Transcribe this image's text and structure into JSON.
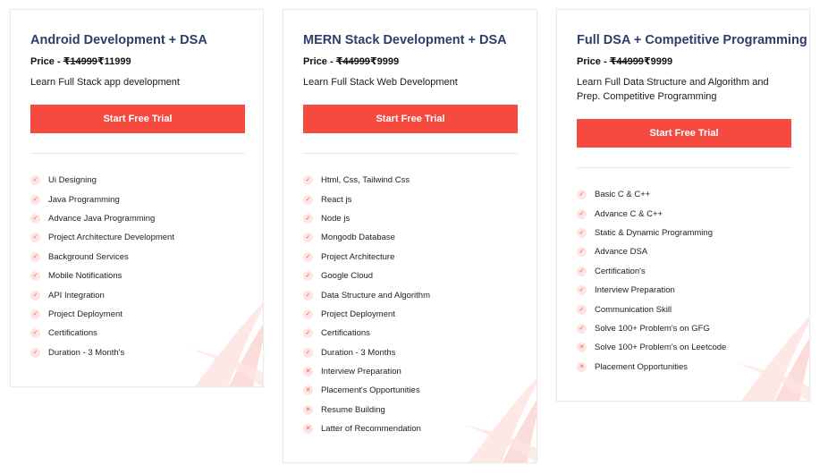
{
  "colors": {
    "accent": "#f44a3f",
    "title": "#2d3e6b",
    "check_bg": "#fde5e3",
    "check_fg": "#f15b50"
  },
  "plans": [
    {
      "title": "Android Development + DSA",
      "price_label": "Price - ",
      "old_price": "₹14999",
      "new_price": "₹11999",
      "description": "Learn Full Stack app development",
      "cta": "Start Free Trial",
      "features": [
        {
          "text": "Ui Designing",
          "icon": "check-icon",
          "glyph": "✓"
        },
        {
          "text": "Java Programming",
          "icon": "check-icon",
          "glyph": "✓"
        },
        {
          "text": "Advance Java Programming",
          "icon": "check-icon",
          "glyph": "✓"
        },
        {
          "text": "Project Architecture Development",
          "icon": "check-icon",
          "glyph": "✓"
        },
        {
          "text": "Background Services",
          "icon": "check-icon",
          "glyph": "✓"
        },
        {
          "text": "Mobile Notifications",
          "icon": "check-icon",
          "glyph": "✓"
        },
        {
          "text": "API Integration",
          "icon": "check-icon",
          "glyph": "✓"
        },
        {
          "text": "Project Deployment",
          "icon": "check-icon",
          "glyph": "✓"
        },
        {
          "text": "Certifications",
          "icon": "check-icon",
          "glyph": "✓"
        },
        {
          "text": "Duration - 3 Month's",
          "icon": "check-icon",
          "glyph": "✓"
        }
      ]
    },
    {
      "title": "MERN Stack Development + DSA",
      "price_label": "Price - ",
      "old_price": "₹44999",
      "new_price": "₹9999",
      "description": "Learn Full Stack Web Development",
      "cta": "Start Free Trial",
      "features": [
        {
          "text": "Html, Css, Tailwind Css",
          "icon": "check-icon",
          "glyph": "✓"
        },
        {
          "text": "React js",
          "icon": "check-icon",
          "glyph": "✓"
        },
        {
          "text": "Node js",
          "icon": "check-icon",
          "glyph": "✓"
        },
        {
          "text": "Mongodb Database",
          "icon": "check-icon",
          "glyph": "✓"
        },
        {
          "text": "Project Architecture",
          "icon": "check-icon",
          "glyph": "✓"
        },
        {
          "text": "Google Cloud",
          "icon": "check-icon",
          "glyph": "✓"
        },
        {
          "text": "Data Structure and Algorithm",
          "icon": "check-icon",
          "glyph": "✓"
        },
        {
          "text": "Project Deployment",
          "icon": "check-icon",
          "glyph": "✓"
        },
        {
          "text": "Certifications",
          "icon": "check-icon",
          "glyph": "✓"
        },
        {
          "text": "Duration - 3 Months",
          "icon": "check-icon",
          "glyph": "✓"
        },
        {
          "text": "Interview Preparation",
          "icon": "cross-icon",
          "glyph": "✕"
        },
        {
          "text": "Placement's Opportunities",
          "icon": "cross-icon",
          "glyph": "✕"
        },
        {
          "text": "Resume Building",
          "icon": "cross-icon",
          "glyph": "✕"
        },
        {
          "text": "Latter of Recommendation",
          "icon": "cross-icon",
          "glyph": "✕"
        }
      ]
    },
    {
      "title": "Full DSA + Competitive Programming",
      "price_label": "Price - ",
      "old_price": "₹44999",
      "new_price": "₹9999",
      "description": "Learn Full Data Structure and Algorithm and Prep. Competitive Programming",
      "cta": "Start Free Trial",
      "features": [
        {
          "text": "Basic C & C++",
          "icon": "check-icon",
          "glyph": "✓"
        },
        {
          "text": "Advance C & C++",
          "icon": "check-icon",
          "glyph": "✓"
        },
        {
          "text": "Static & Dynamic Programming",
          "icon": "check-icon",
          "glyph": "✓"
        },
        {
          "text": "Advance DSA",
          "icon": "check-icon",
          "glyph": "✓"
        },
        {
          "text": "Certification's",
          "icon": "check-icon",
          "glyph": "✓"
        },
        {
          "text": "Interview Preparation",
          "icon": "check-icon",
          "glyph": "✓"
        },
        {
          "text": "Communication Skill",
          "icon": "check-icon",
          "glyph": "✓"
        },
        {
          "text": "Solve 100+ Problem's on GFG",
          "icon": "check-icon",
          "glyph": "✓"
        },
        {
          "text": "Solve 100+ Problem's on Leetcode",
          "icon": "cross-icon",
          "glyph": "✕"
        },
        {
          "text": "Placement Opportunities",
          "icon": "cross-icon",
          "glyph": "✕"
        }
      ]
    }
  ]
}
